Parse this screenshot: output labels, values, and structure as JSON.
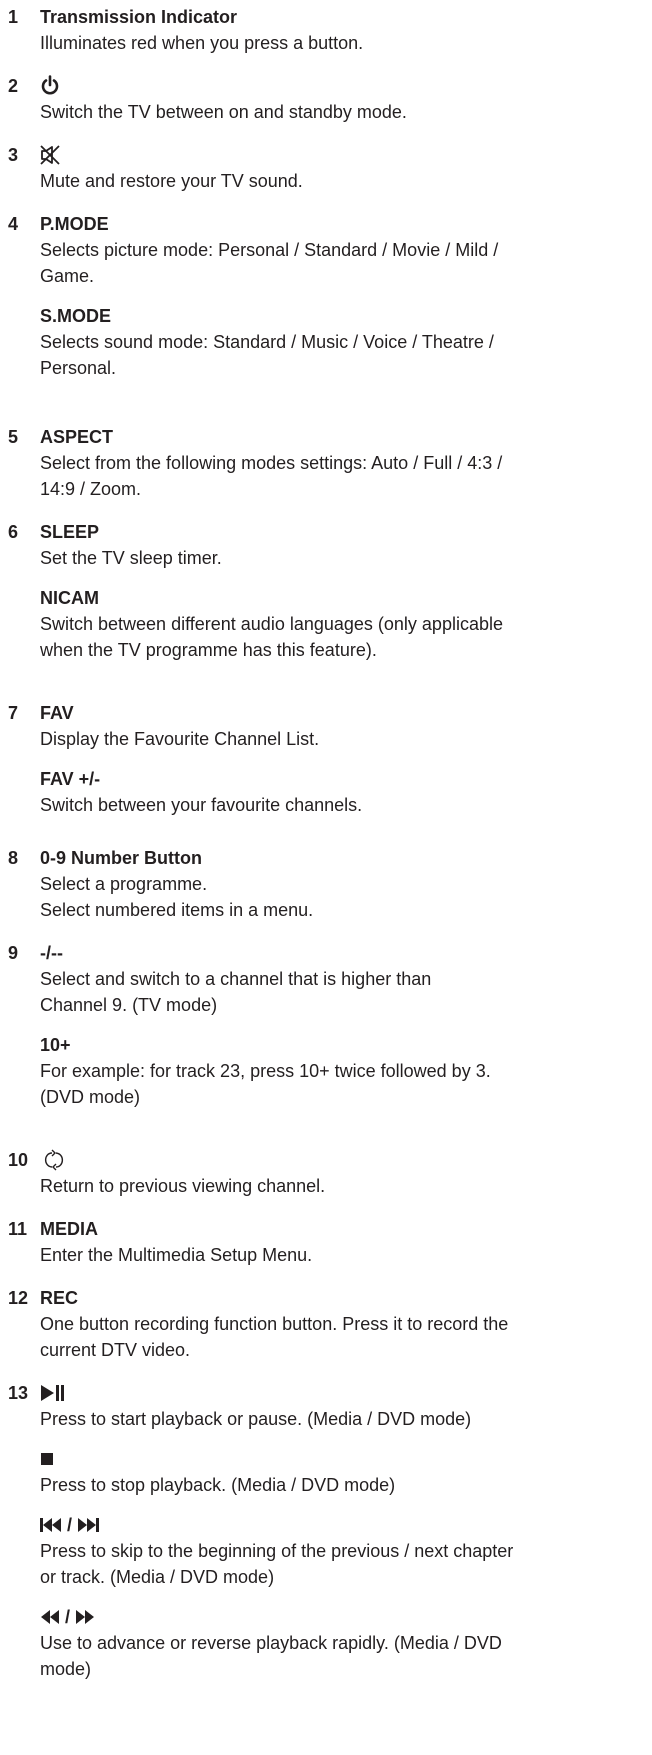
{
  "entries": [
    {
      "num": "1",
      "title": "Transmission Indicator",
      "desc": "Illuminates red when you press a button."
    },
    {
      "num": "2",
      "icon": "power-icon",
      "desc": "Switch the TV between on and standby mode."
    },
    {
      "num": "3",
      "icon": "mute-icon",
      "desc": "Mute and restore your TV sound."
    },
    {
      "num": "4",
      "title": "P.MODE",
      "desc": [
        "Selects picture mode:  Personal / Standard / Movie / Mild /",
        "Game."
      ],
      "sub": {
        "title": "S.MODE",
        "desc": [
          "Selects sound mode:  Standard / Music / Voice / Theatre /",
          "Personal."
        ]
      }
    },
    {
      "num": "5",
      "title": "ASPECT",
      "desc": [
        "Select from the following modes settings: Auto / Full / 4:3 /",
        "14:9 / Zoom."
      ]
    },
    {
      "num": "6",
      "title": "SLEEP",
      "desc": "Set the TV sleep timer.",
      "sub": {
        "title": "NICAM",
        "desc": [
          "Switch between different audio languages (only applicable",
          "when the TV programme has this feature)."
        ]
      }
    },
    {
      "num": "7",
      "title": "FAV",
      "desc": "Display the Favourite Channel List.",
      "sub": {
        "title": "FAV +/-",
        "desc": "Switch between your favourite channels."
      }
    },
    {
      "num": "8",
      "title": "0-9 Number Button",
      "desc": [
        "Select a programme.",
        "Select numbered items in a menu."
      ]
    },
    {
      "num": "9",
      "title": "-/--",
      "desc": [
        "Select and switch to a channel that is higher than",
        "Channel 9. (TV mode)"
      ],
      "sub": {
        "title": "10+",
        "desc": [
          "For example: for track 23, press 10+ twice followed by 3.",
          "(DVD mode)"
        ]
      }
    },
    {
      "num": "10",
      "icon": "recall-icon",
      "desc": "Return to previous viewing channel."
    },
    {
      "num": "11",
      "title": "MEDIA",
      "desc": "Enter the Multimedia Setup Menu."
    },
    {
      "num": "12",
      "title": "REC",
      "desc": [
        "One button recording function button. Press it to record the",
        "current DTV video."
      ]
    },
    {
      "num": "13",
      "icon": "play-pause-icon",
      "desc": "Press to start playback or pause. (Media / DVD mode)"
    }
  ],
  "extra": [
    {
      "icon": "stop-icon",
      "desc": "Press to stop playback. (Media / DVD mode)"
    },
    {
      "icon": "skip-icons",
      "sep": "/",
      "desc": [
        "Press to skip to the beginning of the previous / next chapter",
        "or track. (Media / DVD mode)"
      ]
    },
    {
      "icon": "fast-icons",
      "sep": "/",
      "desc": [
        "Use to advance or reverse playback rapidly. (Media / DVD",
        "mode)"
      ]
    }
  ]
}
